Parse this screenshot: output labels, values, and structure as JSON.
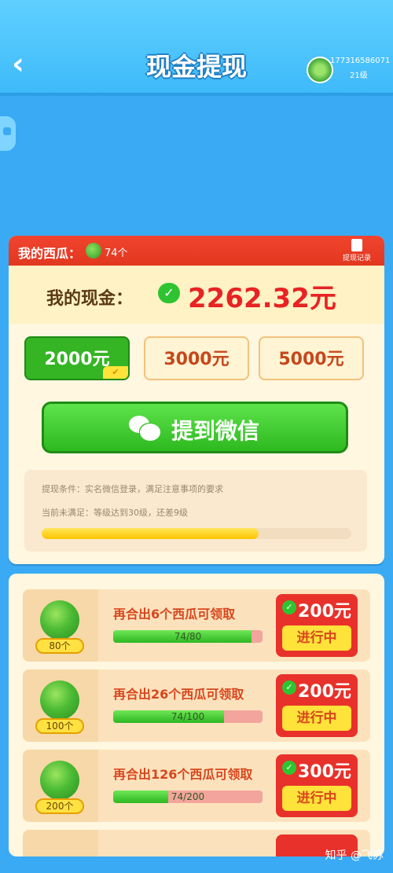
{
  "header": {
    "title": "现金提现",
    "back_icon": "chevron-left-icon",
    "user_id": "17731658607​1",
    "level": "21级"
  },
  "wallet": {
    "melon_label": "我的西瓜：",
    "melon_count": "74个",
    "record_label": "提现记录",
    "cash_label": "我的现金：",
    "cash_value": "2262.32元"
  },
  "amounts": [
    {
      "label": "2000元",
      "selected": true
    },
    {
      "label": "3000元",
      "selected": false
    },
    {
      "label": "5000元",
      "selected": false
    }
  ],
  "withdraw_button": "提到微信",
  "conditions": {
    "line1": "提现条件：实名微信登录，满足注意事项的要求",
    "line2": "当前未满足：等级达到30级，还差9级",
    "progress": 0.7
  },
  "tasks": [
    {
      "tag": "80个",
      "text": "再合出6个西瓜可领取",
      "progress_text": "74/80",
      "progress": 0.925,
      "reward": "200元",
      "status": "进行中"
    },
    {
      "tag": "100个",
      "text": "再合出26个西瓜可领取",
      "progress_text": "74/100",
      "progress": 0.74,
      "reward": "200元",
      "status": "进行中"
    },
    {
      "tag": "200个",
      "text": "再合出126个西瓜可领取",
      "progress_text": "74/200",
      "progress": 0.37,
      "reward": "300元",
      "status": "进行中"
    }
  ],
  "watermark": "知乎 @飞苏",
  "colors": {
    "background": "#3aaaf4",
    "accent_red": "#e72323",
    "button_green": "#35b524"
  }
}
